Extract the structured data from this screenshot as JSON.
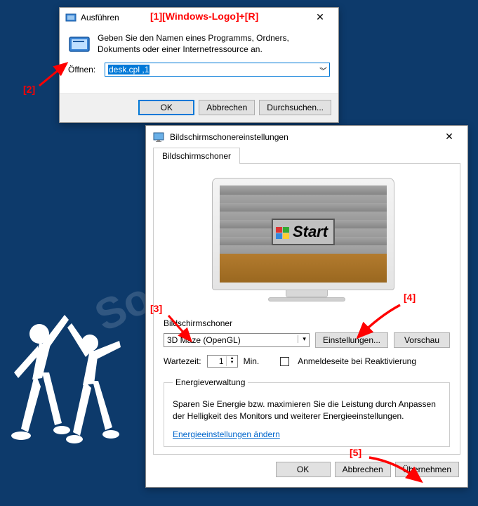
{
  "watermark": "SoftwareOK.de",
  "annotations": {
    "a1": "[1][Windows-Logo]+[R]",
    "a2": "[2]",
    "a3": "[3]",
    "a4": "[4]",
    "a5": "[5]"
  },
  "run": {
    "title": "Ausführen",
    "desc": "Geben Sie den Namen eines Programms, Ordners, Dokuments oder einer Internetressource an.",
    "open_label": "Öffnen:",
    "command": "desk.cpl ,1",
    "ok": "OK",
    "cancel": "Abbrechen",
    "browse": "Durchsuchen..."
  },
  "scr": {
    "title": "Bildschirmschonereinstellungen",
    "tab": "Bildschirmschoner",
    "preview_banner": "Start",
    "group_label": "Bildschirmschoner",
    "select_value": "3D Maze (OpenGL)",
    "btn_settings": "Einstellungen...",
    "btn_preview": "Vorschau",
    "wait_label": "Wartezeit:",
    "wait_value": "1",
    "wait_unit": "Min.",
    "resume_label": "Anmeldeseite bei Reaktivierung",
    "energy_legend": "Energieverwaltung",
    "energy_text": "Sparen Sie Energie bzw. maximieren Sie die Leistung durch Anpassen der Helligkeit des Monitors und weiterer Energieeinstellungen.",
    "energy_link": "Energieeinstellungen ändern",
    "ok": "OK",
    "cancel": "Abbrechen",
    "apply": "Übernehmen"
  }
}
